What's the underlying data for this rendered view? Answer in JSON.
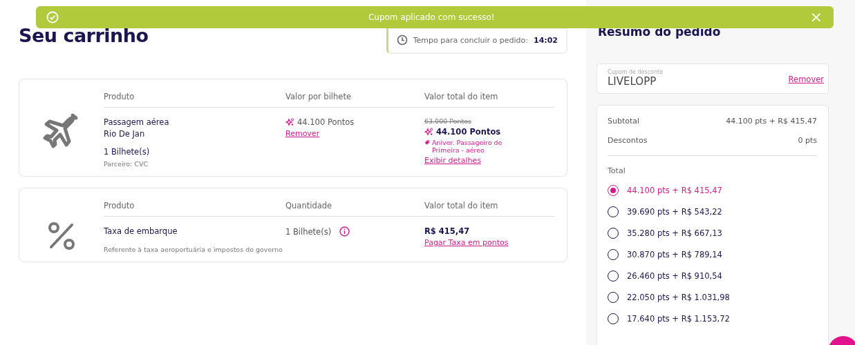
{
  "toast": {
    "message": "Cupom aplicado com sucesso!",
    "close": "×"
  },
  "page_title": "Seu carrinho",
  "timer": {
    "label": "Tempo para concluir o pedido:",
    "time": "14:02"
  },
  "cart_items": [
    {
      "kind": "flight",
      "columns": [
        "Produto",
        "Valor por bilhete",
        "Valor total do item"
      ],
      "product": {
        "name": "Passagem aérea",
        "route": "Rio De Jan",
        "quantity": "1 Bilhete(s)",
        "partner": "Parceiro: CVC"
      },
      "unit_price": {
        "points": "44.100 Pontos",
        "remove": "Remover"
      },
      "total": {
        "old": "63.000 Pontos",
        "points": "44.100 Pontos",
        "promo": "Aniver. Passageiro de Primeira - aéreo",
        "details": "Exibir detalhes"
      }
    },
    {
      "kind": "fee",
      "columns": [
        "Produto",
        "Quantidade",
        "Valor total do item"
      ],
      "product": {
        "name": "Taxa de embarque",
        "note": "Referente à taxa aeroportuária e impostos do governo"
      },
      "quantity": "1 Bilhete(s)",
      "total": {
        "price": "R$ 415,47",
        "pay_with_points": "Pagar Taxa em pontos"
      }
    }
  ],
  "summary": {
    "title": "Resumo do pedido",
    "coupon": {
      "label": "Cupom de desconto",
      "value": "LIVELOPP",
      "remove": "Remover"
    },
    "lines": [
      {
        "label": "Subtotal",
        "value": "44.100 pts + R$ 415,47"
      },
      {
        "label": "Descontos",
        "value": "0 pts"
      }
    ],
    "total_label": "Total",
    "options": [
      {
        "label": "44.100 pts + R$ 415,47",
        "selected": true
      },
      {
        "label": "39.690 pts + R$ 543,22",
        "selected": false
      },
      {
        "label": "35.280 pts + R$ 667,13",
        "selected": false
      },
      {
        "label": "30.870 pts + R$ 789,14",
        "selected": false
      },
      {
        "label": "26.460 pts + R$ 910,54",
        "selected": false
      },
      {
        "label": "22.050 pts + R$ 1.031,98",
        "selected": false
      },
      {
        "label": "17.640 pts + R$ 1.153,72",
        "selected": false
      }
    ]
  }
}
